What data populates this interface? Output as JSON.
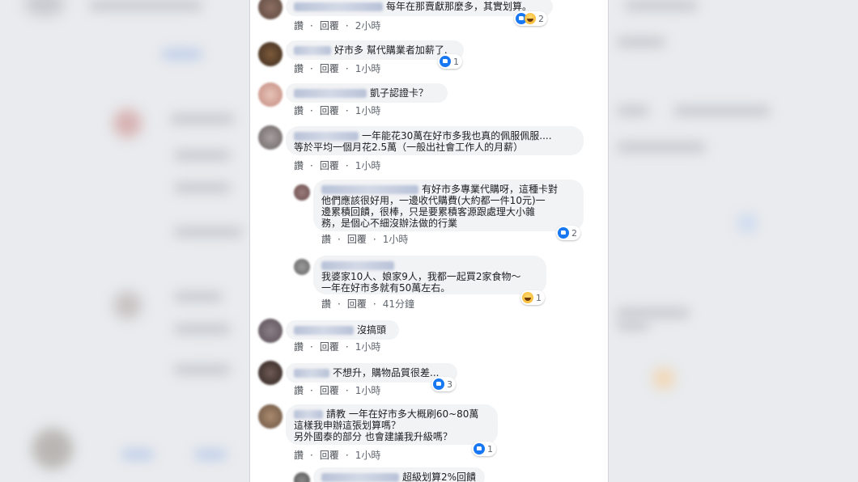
{
  "ui": {
    "like_label": "讚",
    "reply_label": "回覆"
  },
  "comments": [
    {
      "text": "每年在那賣獻那麼多，其實划算。",
      "time": "2小時",
      "reactions": "2",
      "reaction_types": [
        "like-icon",
        "haha-icon"
      ]
    },
    {
      "text": "好市多 幫代購業者加薪了.",
      "time": "1小時",
      "reactions": "1",
      "reaction_types": [
        "like-icon"
      ]
    },
    {
      "text": "凱子認證卡？",
      "time": "1小時",
      "reactions": "",
      "reaction_types": []
    },
    {
      "text_lines": [
        "一年能花30萬在好市多我也真的佩服佩服....",
        "等於平均一個月花2.5萬（一般出社會工作人的月薪）"
      ],
      "time": "1小時",
      "reactions": "",
      "reaction_types": []
    },
    {
      "reply": true,
      "text_lines": [
        "有好市多專業代購呀，這種卡對",
        "他們應該很好用，一邊收代購費(大約都一件10元)一",
        "邊累積回饋，很棒，只是要累積客源跟處理大小雜",
        "務，是個心不細沒辦法做的行業"
      ],
      "time": "1小時",
      "reactions": "2",
      "reaction_types": [
        "like-icon"
      ]
    },
    {
      "reply": true,
      "text_lines": [
        "我婆家10人、娘家9人，我都一起買2家食物～",
        "一年在好市多就有50萬左右。"
      ],
      "time": "41分鐘",
      "reactions": "1",
      "reaction_types": [
        "haha-icon"
      ]
    },
    {
      "text": "沒搞頭",
      "time": "1小時",
      "reactions": "",
      "reaction_types": []
    },
    {
      "text": "不想升，購物品質很差...",
      "time": "1小時",
      "reactions": "3",
      "reaction_types": [
        "like-icon"
      ]
    },
    {
      "text_lines": [
        "請教 一年在好市多大概刷60~80萬",
        "這樣我申辦這張划算嗎？",
        "另外國泰的部分 也會建議我升級嗎？"
      ],
      "time": "1小時",
      "reactions": "1",
      "reaction_types": [
        "like-icon"
      ]
    },
    {
      "reply": true,
      "text": "超級划算2%回饋",
      "time": "",
      "reactions": "",
      "reaction_types": []
    }
  ]
}
